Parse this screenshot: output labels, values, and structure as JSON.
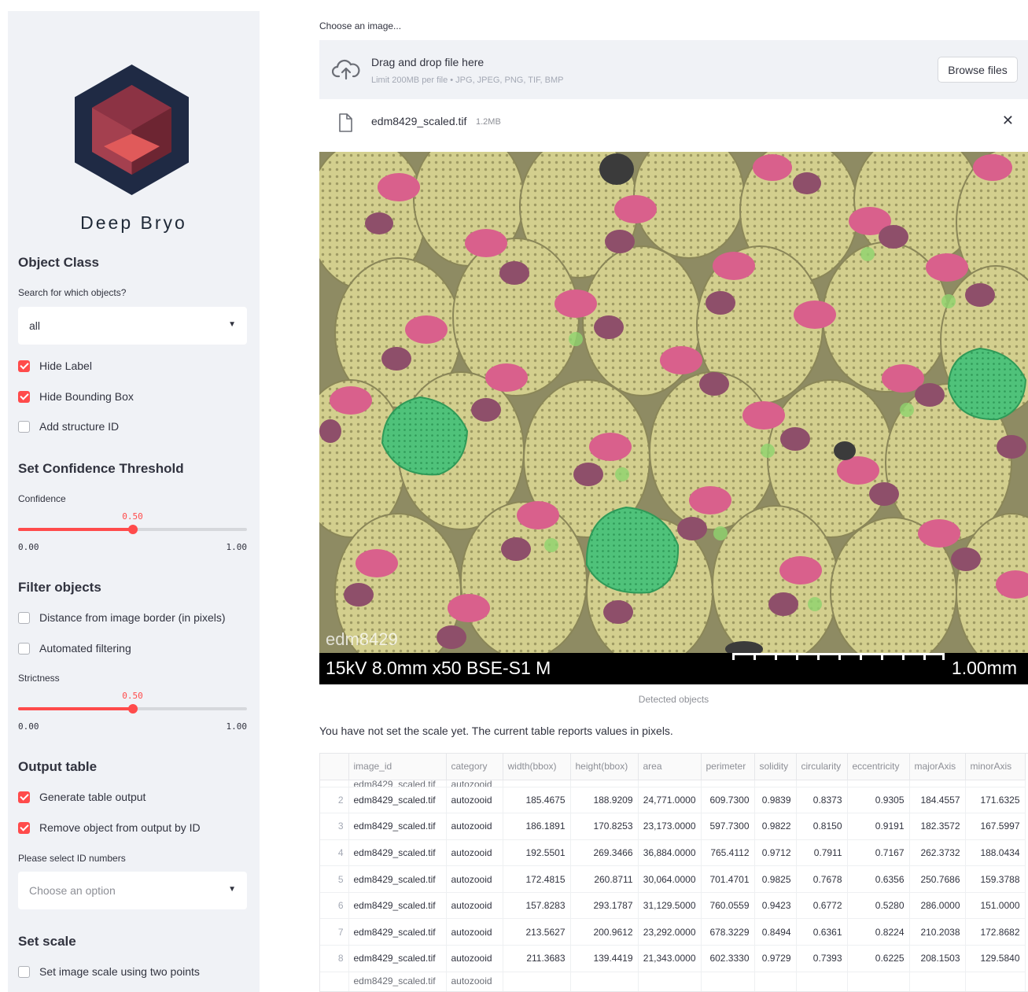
{
  "sidebar": {
    "brand": "Deep Bryo",
    "object_class": {
      "heading": "Object Class",
      "select_label": "Search for which objects?",
      "select_value": "all"
    },
    "checkboxes_display": [
      {
        "label": "Hide Label",
        "checked": true
      },
      {
        "label": "Hide Bounding Box",
        "checked": true
      },
      {
        "label": "Add structure ID",
        "checked": false
      }
    ],
    "confidence": {
      "heading": "Set Confidence Threshold",
      "label": "Confidence",
      "value": "0.50",
      "min": "0.00",
      "max": "1.00",
      "fraction": 0.5
    },
    "filter": {
      "heading": "Filter objects",
      "border_checkbox": {
        "label": "Distance from image border (in pixels)",
        "checked": false
      },
      "auto_checkbox": {
        "label": "Automated filtering",
        "checked": false
      },
      "strictness_label": "Strictness",
      "strictness_value": "0.50",
      "strictness_min": "0.00",
      "strictness_max": "1.00",
      "strictness_fraction": 0.5
    },
    "output": {
      "heading": "Output table",
      "generate_checkbox": {
        "label": "Generate table output",
        "checked": true
      },
      "remove_checkbox": {
        "label": "Remove object from output by ID",
        "checked": true
      },
      "select_label": "Please select ID numbers",
      "select_placeholder": "Choose an option"
    },
    "scale": {
      "heading": "Set scale",
      "two_points_checkbox": {
        "label": "Set image scale using two points",
        "checked": false
      }
    }
  },
  "uploader": {
    "label": "Choose an image...",
    "drop_title": "Drag and drop file here",
    "drop_limits": "Limit 200MB per file • JPG, JPEG, PNG, TIF, BMP",
    "browse_label": "Browse files",
    "file_name": "edm8429_scaled.tif",
    "file_size": "1.2MB"
  },
  "image": {
    "sample_tag": "edm8429",
    "sem_info": "15kV 8.0mm x50 BSE-S1 M",
    "scale_bar": "1.00mm",
    "caption": "Detected objects"
  },
  "scale_note": "You have not set the scale yet. The current table reports values in pixels.",
  "table": {
    "columns": [
      "",
      "image_id",
      "category",
      "width(bbox)",
      "height(bbox)",
      "area",
      "perimeter",
      "solidity",
      "circularity",
      "eccentricity",
      "majorAxis",
      "minorAxis"
    ],
    "rows": [
      [
        "2",
        "edm8429_scaled.tif",
        "autozooid",
        "185.4675",
        "188.9209",
        "24,771.0000",
        "609.7300",
        "0.9839",
        "0.8373",
        "0.9305",
        "184.4557",
        "171.6325"
      ],
      [
        "3",
        "edm8429_scaled.tif",
        "autozooid",
        "186.1891",
        "170.8253",
        "23,173.0000",
        "597.7300",
        "0.9822",
        "0.8150",
        "0.9191",
        "182.3572",
        "167.5997"
      ],
      [
        "4",
        "edm8429_scaled.tif",
        "autozooid",
        "192.5501",
        "269.3466",
        "36,884.0000",
        "765.4112",
        "0.9712",
        "0.7911",
        "0.7167",
        "262.3732",
        "188.0434"
      ],
      [
        "5",
        "edm8429_scaled.tif",
        "autozooid",
        "172.4815",
        "260.8711",
        "30,064.0000",
        "701.4701",
        "0.9825",
        "0.7678",
        "0.6356",
        "250.7686",
        "159.3788"
      ],
      [
        "6",
        "edm8429_scaled.tif",
        "autozooid",
        "157.8283",
        "293.1787",
        "31,129.5000",
        "760.0559",
        "0.9423",
        "0.6772",
        "0.5280",
        "286.0000",
        "151.0000"
      ],
      [
        "7",
        "edm8429_scaled.tif",
        "autozooid",
        "213.5627",
        "200.9612",
        "23,292.0000",
        "678.3229",
        "0.8494",
        "0.6361",
        "0.8224",
        "210.2038",
        "172.8682"
      ],
      [
        "8",
        "edm8429_scaled.tif",
        "autozooid",
        "211.3683",
        "139.4419",
        "21,343.0000",
        "602.3330",
        "0.9729",
        "0.7393",
        "0.6225",
        "208.1503",
        "129.5840"
      ]
    ]
  },
  "colors": {
    "accent": "#ff4b4b",
    "sidebar_bg": "#f0f2f6",
    "logo_navy": "#1f2a44",
    "zooid_yellow": "#cfcb8a",
    "orifice_pink": "#d9608c",
    "ovicell_green": "#4fc27a"
  }
}
